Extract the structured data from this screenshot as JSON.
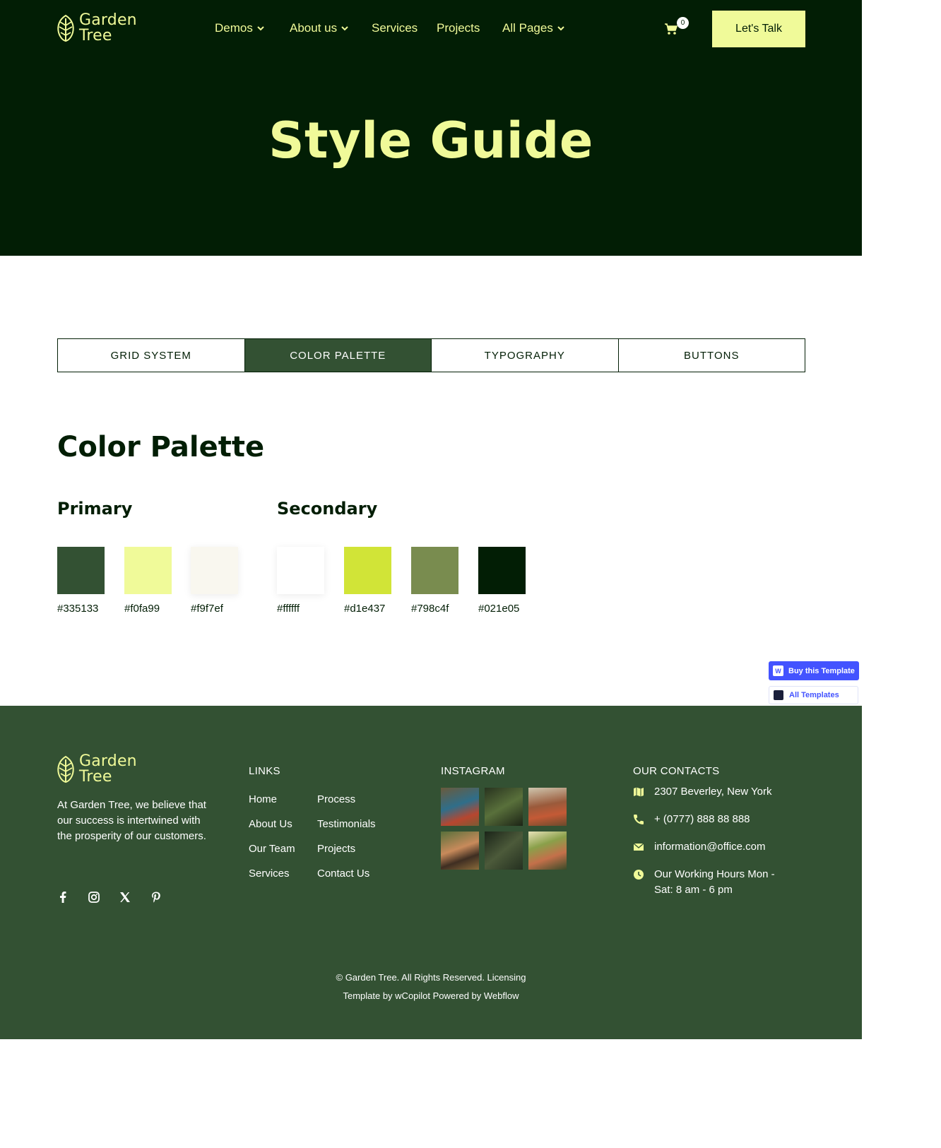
{
  "brand": {
    "name_line1": "Garden",
    "name_line2": "Tree"
  },
  "nav": {
    "items": [
      {
        "label": "Demos",
        "has_dropdown": true
      },
      {
        "label": "About us",
        "has_dropdown": true
      },
      {
        "label": "Services",
        "has_dropdown": false
      },
      {
        "label": "Projects",
        "has_dropdown": false
      },
      {
        "label": "All Pages",
        "has_dropdown": true
      }
    ],
    "cart_icon": "cart-icon",
    "cart_count": "0",
    "cta_label": "Let's Talk"
  },
  "hero": {
    "title": "Style Guide"
  },
  "tabs": {
    "items": [
      "GRID SYSTEM",
      "COLOR PALETTE",
      "TYPOGRAPHY",
      "BUTTONS"
    ],
    "active": "COLOR PALETTE"
  },
  "palette": {
    "title": "Color Palette",
    "primary": {
      "title": "Primary",
      "swatches": [
        {
          "hex": "#335133",
          "label": "#335133"
        },
        {
          "hex": "#f0fa99",
          "label": "#f0fa99"
        },
        {
          "hex": "#f9f7ef",
          "label": "#f9f7ef"
        }
      ]
    },
    "secondary": {
      "title": "Secondary",
      "swatches": [
        {
          "hex": "#ffffff",
          "label": "#ffffff"
        },
        {
          "hex": "#d1e437",
          "label": "#d1e437"
        },
        {
          "hex": "#798c4f",
          "label": "#798c4f"
        },
        {
          "hex": "#021e05",
          "label": "#021e05"
        }
      ]
    }
  },
  "floating": {
    "buy_label": "Buy this Template",
    "all_label": "All Templates"
  },
  "footer": {
    "about": "At Garden Tree, we believe that our success is intertwined with the prosperity of our customers.",
    "socials": [
      "facebook-icon",
      "instagram-icon",
      "x-icon",
      "pinterest-icon"
    ],
    "links": {
      "title": "LINKS",
      "col1": [
        "Home",
        "About Us",
        "Our Team",
        "Services"
      ],
      "col2": [
        "Process",
        "Testimonials",
        "Projects",
        "Contact Us"
      ]
    },
    "instagram": {
      "title": "INSTAGRAM"
    },
    "contacts": {
      "title": "OUR CONTACTS",
      "address": "2307 Beverley, New York",
      "phone": "+ (0777) 888 88 888",
      "email": "information@office.com",
      "hours": "Our Working Hours Mon - Sat: 8 am - 6 pm"
    },
    "copyright_line1": "© Garden Tree. All Rights Reserved. Licensing",
    "copyright_line2": "Template by wCopilot Powered by Webflow"
  },
  "colors": {
    "dark": "#021e05",
    "forest": "#335133",
    "lime": "#f0fa99",
    "accent_blue": "#4353ff"
  }
}
